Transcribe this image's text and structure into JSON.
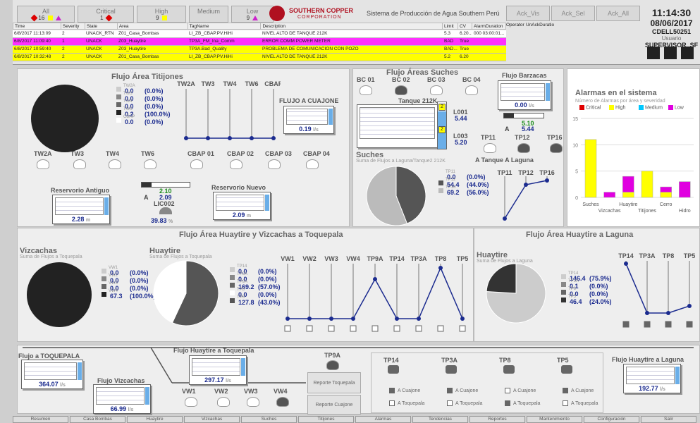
{
  "filters": [
    {
      "label": "All",
      "count": "16"
    },
    {
      "label": "Critical",
      "count": "1"
    },
    {
      "label": "High",
      "count": "9"
    },
    {
      "label": "Medium",
      "count": "0"
    },
    {
      "label": "Low",
      "count": "9"
    }
  ],
  "logo": {
    "name": "SOUTHERN COPPER",
    "sub": "CORPORATION"
  },
  "system_title": "Sistema de Producción de Agua Southern Perú",
  "ack_buttons": [
    "Ack_Vis",
    "Ack_Sel",
    "Ack_All"
  ],
  "clock": {
    "time": "11:14:30",
    "date": "08/06/2017",
    "host": "CDELL50251",
    "user_label": "Usuario",
    "user": "SUPERVISOR_SF"
  },
  "alarm_table": {
    "headers": [
      "Time",
      "Severity",
      "State",
      "Area",
      "TagName",
      "Description",
      "Limit",
      "CV",
      "AlarmDuration",
      "Operator",
      "UnAckDuratio"
    ],
    "rows": [
      {
        "time": "6/8/2017 11:13:09",
        "severity": "2",
        "state": "UNACK_RTN",
        "area": "Z01_Casa_Bombas",
        "tag": "LI_ZB_CBAP.PV.HiHi",
        "desc": "NIVEL ALTO DE TANQUE 212K",
        "limit": "5.3",
        "cv": "6.20...",
        "dur": "000 03:00:01...",
        "bg": "#ffffff"
      },
      {
        "time": "6/8/2017 11:09:40",
        "severity": "1",
        "state": "UNACK",
        "area": "Z03_Huaytire",
        "tag": "TP3A_FM_Ina_Comm",
        "desc": "ERROR COMM POWER METER",
        "limit": "BAD",
        "cv": "True",
        "dur": "",
        "bg": "#ff30ff"
      },
      {
        "time": "6/8/2017 10:59:40",
        "severity": "2",
        "state": "UNACK",
        "area": "Z03_Huaytire",
        "tag": "TP3A.Bad_Quality",
        "desc": "PROBLEMA DE COMUNICACION CON POZO",
        "limit": "BAD...",
        "cv": "True",
        "dur": "",
        "bg": "#ffff00"
      },
      {
        "time": "6/8/2017 10:32:48",
        "severity": "2",
        "state": "UNACK",
        "area": "Z01_Casa_Bombas",
        "tag": "LI_ZB_CBAP.PV.HiHi",
        "desc": "NIVEL ALTO DE TANQUE 212K",
        "limit": "5.2",
        "cv": "6.20",
        "dur": "",
        "bg": "#ffff00"
      }
    ]
  },
  "titijones": {
    "title": "Flujo Área Titijones",
    "legend": [
      {
        "name": "TW2A",
        "value": "0.0",
        "pct": "(0.0%)"
      },
      {
        "name": "TW3",
        "value": "0.0",
        "pct": "(0.0%)"
      },
      {
        "name": "TW4",
        "value": "0.0",
        "pct": "(0.0%)"
      },
      {
        "name": "TW6",
        "value": "0.2",
        "pct": "(100.0%)"
      },
      {
        "name": "CBAP",
        "value": "0.0",
        "pct": "(0.0%)"
      }
    ],
    "line_labels": [
      "TW2A",
      "TW3",
      "TW4",
      "TW6",
      "CBAP"
    ],
    "flujo_cuajone": {
      "title": "FLUJO A CUAJONE",
      "value": "0.19"
    },
    "pumps": [
      "TW2A",
      "TW3",
      "TW4",
      "TW6",
      "CBAP 01",
      "CBAP 02",
      "CBAP 03",
      "CBAP 04"
    ],
    "res_antiguo": {
      "title": "Reservorio Antiguo",
      "value": "2.28"
    },
    "res_nuevo": {
      "title": "Reservorio Nuevo",
      "value": "2.09"
    },
    "lic": {
      "tag": "LIC002",
      "sp": "2.10",
      "pv": "2.09",
      "out": "39.83",
      "mode": "A"
    }
  },
  "suches": {
    "title": "Flujo Áreas Suches",
    "bc": [
      "BC 01",
      "BC 02",
      "BC 03",
      "BC 04"
    ],
    "tank": {
      "title": "Tanque 212K",
      "l001": "L001",
      "l001v": "5.44",
      "l003": "L003",
      "l003v": "5.20",
      "badge": "2"
    },
    "pie_title": "Suches",
    "pie_sub": "Suma de Flujos a Laguna/Tanque2 212K",
    "legend": [
      {
        "name": "TP11",
        "value": "0.0",
        "pct": "(0.0%)"
      },
      {
        "name": "TP12",
        "value": "54.4",
        "pct": "(44.0%)"
      },
      {
        "name": "TP16",
        "value": "69.2",
        "pct": "(56.0%)"
      }
    ],
    "pumps": [
      "TP11",
      "TP12",
      "TP16"
    ],
    "laguna": "A Tanque",
    "laguna2": "A Laguna",
    "line_labels": [
      "TP11",
      "TP12",
      "TP16"
    ]
  },
  "barzacas": {
    "title": "Flujo Barzacas",
    "value": "0.00",
    "sp": "5.10",
    "pv": "5.44",
    "mode": "A"
  },
  "alarm_chart": {
    "title": "Alarmas en el sistema",
    "subtitle": "Número de Alarmas por área y severidad",
    "legend": [
      {
        "name": "Critical",
        "color": "#e00000"
      },
      {
        "name": "High",
        "color": "#ffff00"
      },
      {
        "name": "Medium",
        "color": "#00c8ff"
      },
      {
        "name": "Low",
        "color": "#e000e0"
      }
    ]
  },
  "chart_data": {
    "type": "bar",
    "title": "Alarmas en el sistema",
    "subtitle": "Número de Alarmas por área y severidad",
    "categories": [
      "Suches",
      "Vizcachas",
      "Huaytire",
      "Titijones",
      "Cerro",
      "Hidro"
    ],
    "ylim": [
      0,
      15
    ],
    "series": [
      {
        "name": "Critical",
        "values": [
          0,
          0,
          0,
          0,
          0,
          0
        ]
      },
      {
        "name": "High",
        "values": [
          11,
          0,
          1,
          5,
          1,
          0
        ]
      },
      {
        "name": "Medium",
        "values": [
          0,
          0,
          0,
          0,
          0,
          0
        ]
      },
      {
        "name": "Low",
        "values": [
          0,
          1,
          3,
          0,
          1,
          3
        ]
      }
    ]
  },
  "huaytire_toq": {
    "title": "Flujo Área Huaytire y Vizcachas a Toquepala",
    "viz": {
      "title": "Vizcachas",
      "sub": "Suma de Flujos a Toquepala",
      "legend": [
        {
          "name": "VW1",
          "value": "0.0",
          "pct": "(0.0%)"
        },
        {
          "name": "VW2",
          "value": "0.0",
          "pct": "(0.0%)"
        },
        {
          "name": "VW3",
          "value": "0.0",
          "pct": "(0.0%)"
        },
        {
          "name": "VW4",
          "value": "67.3",
          "pct": "(100.0%)"
        }
      ]
    },
    "huay": {
      "title": "Huaytire",
      "sub": "Suma de Flujos a Toquepala",
      "legend": [
        {
          "name": "TP14",
          "value": "0.0",
          "pct": "(0.0%)"
        },
        {
          "name": "TP3A",
          "value": "0.0",
          "pct": "(0.0%)"
        },
        {
          "name": "TP9A",
          "value": "169.2",
          "pct": "(57.0%)"
        },
        {
          "name": "TP8",
          "value": "0.0",
          "pct": "(0.0%)"
        },
        {
          "name": "TP5",
          "value": "127.8",
          "pct": "(43.0%)"
        }
      ]
    },
    "line_labels": [
      "VW1",
      "VW2",
      "VW3",
      "VW4",
      "TP9A",
      "TP14",
      "TP3A",
      "TP8",
      "TP5"
    ]
  },
  "huaytire_lag": {
    "title": "Flujo Área Huaytire a Laguna",
    "pie_title": "Huaytire",
    "pie_sub": "Suma de Flujos a Laguna",
    "legend": [
      {
        "name": "TP14",
        "value": "146.4",
        "pct": "(75.9%)"
      },
      {
        "name": "TP3A",
        "value": "0.1",
        "pct": "(0.0%)"
      },
      {
        "name": "TP8",
        "value": "0.0",
        "pct": "(0.0%)"
      },
      {
        "name": "TP5",
        "value": "46.4",
        "pct": "(24.0%)"
      }
    ],
    "line_labels": [
      "TP14",
      "TP3A",
      "TP8",
      "TP5"
    ]
  },
  "bottom": {
    "flujo_toq": {
      "title": "Flujo a TOQUEPALA",
      "value": "364.07"
    },
    "flujo_huay_toq": {
      "title": "Flujo Huaytire a Toquepala",
      "value": "297.17"
    },
    "flujo_viz": {
      "title": "Flujo Vizcachas",
      "value": "66.99"
    },
    "flujo_huay_lag": {
      "title": "Flujo Huaytire a Laguna",
      "value": "192.77"
    },
    "vw_pumps": [
      "VW1",
      "VW2",
      "VW3",
      "VW4"
    ],
    "tp9a": "TP9A",
    "reporte_toq": "Reporte Toquepala",
    "reporte_cua": "Reporte Cuajone",
    "valves": [
      {
        "name": "TP14",
        "cuajone": "A Cuajone",
        "toquepala": "A Toquepala",
        "c_on": true,
        "t_on": false
      },
      {
        "name": "TP3A",
        "cuajone": "A Cuajone",
        "toquepala": "A Toquepala",
        "c_on": true,
        "t_on": false
      },
      {
        "name": "TP8",
        "cuajone": "A Cuajone",
        "toquepala": "A Toquepala",
        "c_on": false,
        "t_on": true
      },
      {
        "name": "TP5",
        "cuajone": "A Cuajone",
        "toquepala": "A Toquepala",
        "c_on": true,
        "t_on": false
      }
    ],
    "unit": "l/s"
  },
  "nav": [
    "Resumen",
    "Casa Bombas",
    "Huaytire",
    "Vizcachas",
    "Suches",
    "Titijones",
    "Alarmas",
    "Tendencias",
    "Reportes",
    "Mantenimiento",
    "Configuración",
    "Salir"
  ]
}
